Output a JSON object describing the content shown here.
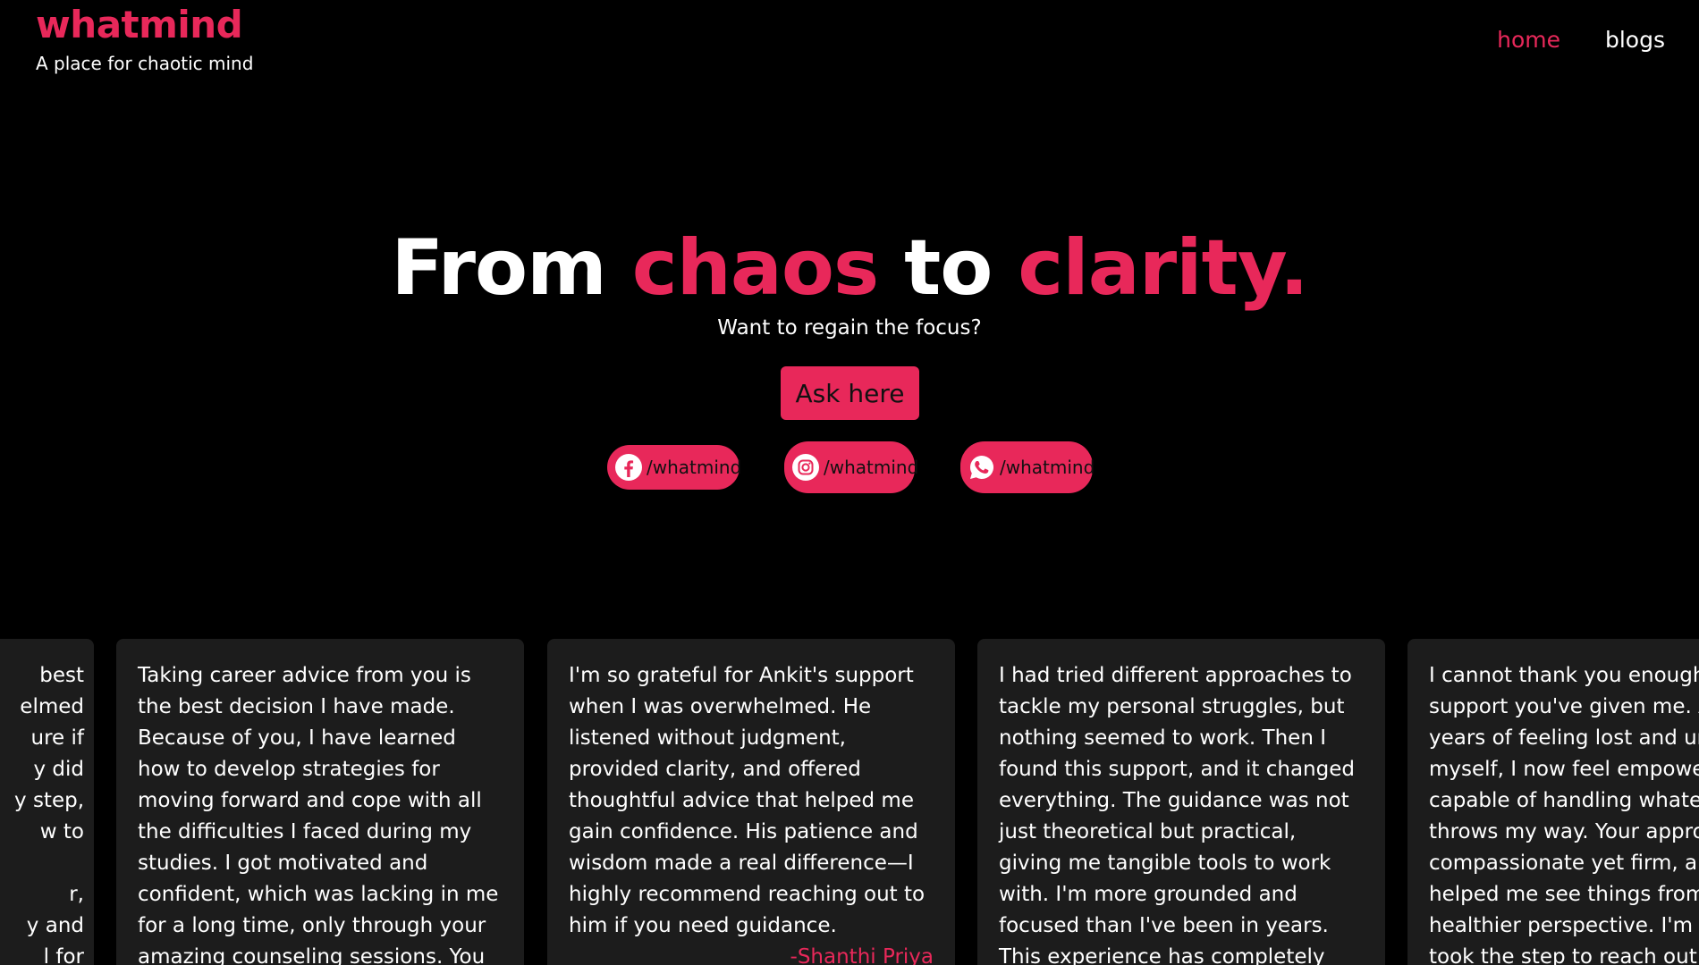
{
  "brand": {
    "name": "whatmind",
    "tagline": "A place for chaotic mind"
  },
  "nav": {
    "items": [
      {
        "label": "home",
        "active": true
      },
      {
        "label": "blogs",
        "active": false
      }
    ]
  },
  "hero": {
    "headline": [
      "From ",
      "chaos",
      " to ",
      "clarity."
    ],
    "subhead": "Want to regain the focus?",
    "cta": "Ask here"
  },
  "socials": [
    {
      "icon": "facebook-icon",
      "label": "/whatmind"
    },
    {
      "icon": "instagram-icon",
      "label": "/whatmind"
    },
    {
      "icon": "whatsapp-icon",
      "label": "/whatmind"
    }
  ],
  "colors": {
    "accent": "#e8285a",
    "background": "#000000",
    "card": "#1c1c1c"
  },
  "testimonials": [
    {
      "lines": [
        "best",
        "elmed",
        "ure if",
        "y did",
        "y step,",
        "w to",
        "",
        "r,",
        "y and",
        "l for"
      ],
      "author": ""
    },
    {
      "quote": "Taking career advice from you is the best decision I have made. Because of you, I have learned how to develop strategies for moving forward and cope with all the difficulties I faced during my studies. I got motivated and confident, which was lacking in me for a long time, only through your amazing counseling sessions. You also offered",
      "author": ""
    },
    {
      "quote": "I'm so grateful for Ankit's support when I was overwhelmed. He listened without judgment, provided clarity, and offered thoughtful advice that helped me gain confidence. His patience and wisdom made a real difference—I highly recommend reaching out to him if you need guidance.",
      "author": "-Shanthi Priya"
    },
    {
      "quote": "I had tried different approaches to tackle my personal struggles, but nothing seemed to work. Then I found this support, and it changed everything. The guidance was not just theoretical but practical, giving me tangible tools to work with. I'm more grounded and focused than I've been in years. This experience has completely shifted my",
      "author": ""
    },
    {
      "quote": "I cannot thank you enough for the support you've given me. After years of feeling lost and unsure of myself, I now feel empowered and capable of handling whatever life throws my way. Your approach is compassionate yet firm, and it helped me see things from a healthier perspective. I'm so glad I took the step to reach out",
      "author": ""
    }
  ]
}
